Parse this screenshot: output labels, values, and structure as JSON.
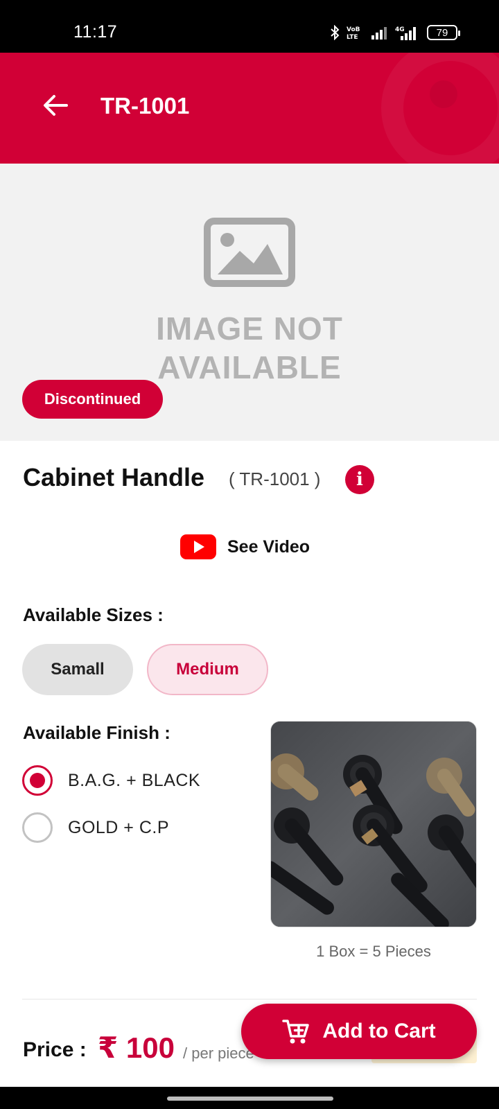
{
  "status_bar": {
    "time": "11:17",
    "battery": "79",
    "icons": [
      "bluetooth-icon",
      "volte-icon",
      "signal-icon",
      "4g-signal-icon",
      "battery-icon"
    ]
  },
  "app_bar": {
    "title": "TR-1001",
    "back_icon": "arrow-left-icon",
    "color": "#d10036"
  },
  "hero": {
    "placeholder_line1": "IMAGE NOT",
    "placeholder_line2": "AVAILABLE",
    "badge": "Discontinued"
  },
  "product": {
    "name": "Cabinet Handle",
    "code": "( TR-1001 )",
    "info_icon": "i"
  },
  "video": {
    "label": "See Video",
    "icon": "youtube-icon"
  },
  "sizes": {
    "label": "Available Sizes :",
    "options": [
      "Samall",
      "Medium"
    ],
    "selected": "Medium"
  },
  "finish": {
    "label": "Available Finish :",
    "options": [
      "B.A.G. + BLACK",
      "GOLD + C.P"
    ],
    "selected": "B.A.G. + BLACK",
    "box_info": "1 Box = 5 Pieces"
  },
  "price": {
    "label": "Price :",
    "value": "₹ 100",
    "unit": "/ per piece"
  },
  "cart": {
    "label": "Add to Cart",
    "icon": "cart-plus-icon"
  },
  "colors": {
    "accent": "#d10036",
    "chip_selected_bg": "#fbe6ec",
    "placeholder_bg": "#f2f2f2"
  }
}
